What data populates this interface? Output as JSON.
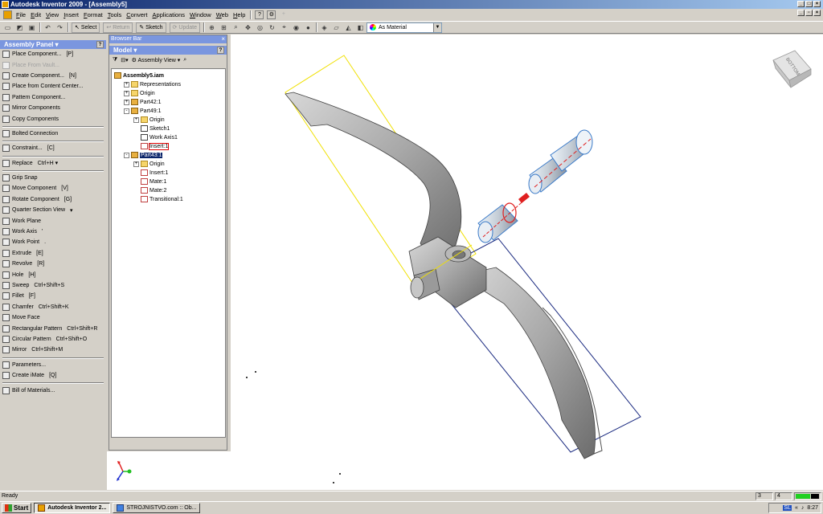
{
  "window": {
    "title": "Autodesk Inventor 2009 - [Assembly5]"
  },
  "menu": [
    "File",
    "Edit",
    "View",
    "Insert",
    "Format",
    "Tools",
    "Convert",
    "Applications",
    "Window",
    "Web",
    "Help"
  ],
  "toolbar": {
    "select_label": "Select",
    "return_label": "Return",
    "sketch_label": "Sketch",
    "update_label": "Update",
    "material_value": "As Material"
  },
  "panel": {
    "title": "Assembly Panel ▾",
    "items": [
      {
        "label": "Place Component...",
        "shortcut": "[P]",
        "icon": "place-component-icon",
        "enabled": true
      },
      {
        "label": "Place From Vault...",
        "shortcut": "",
        "icon": "vault-icon",
        "enabled": false
      },
      {
        "label": "Create Component...",
        "shortcut": "[N]",
        "icon": "create-component-icon",
        "enabled": true
      },
      {
        "label": "Place from Content Center...",
        "shortcut": "",
        "icon": "content-center-icon",
        "enabled": true
      },
      {
        "label": "Pattern Component...",
        "shortcut": "",
        "icon": "pattern-icon",
        "enabled": true
      },
      {
        "label": "Mirror Components",
        "shortcut": "",
        "icon": "mirror-icon",
        "enabled": true
      },
      {
        "label": "Copy Components",
        "shortcut": "",
        "icon": "copy-icon",
        "enabled": true
      },
      {
        "label": "Bolted Connection",
        "shortcut": "",
        "icon": "bolt-icon",
        "enabled": true,
        "sep_before": true
      },
      {
        "label": "Constraint...",
        "shortcut": "[C]",
        "icon": "constraint-icon",
        "enabled": true,
        "sep_before": true
      },
      {
        "label": "Replace",
        "shortcut": "Ctrl+H  ▾",
        "icon": "replace-icon",
        "enabled": true,
        "sep_before": true
      },
      {
        "label": "Grip Snap",
        "shortcut": "",
        "icon": "grip-snap-icon",
        "enabled": true,
        "sep_before": true
      },
      {
        "label": "Move Component",
        "shortcut": "[V]",
        "icon": "move-icon",
        "enabled": true
      },
      {
        "label": "Rotate Component",
        "shortcut": "[G]",
        "icon": "rotate-icon",
        "enabled": true
      },
      {
        "label": "Quarter Section View",
        "shortcut": "▾",
        "icon": "section-icon",
        "enabled": true
      },
      {
        "label": "Work Plane",
        "shortcut": "",
        "icon": "work-plane-icon",
        "enabled": true
      },
      {
        "label": "Work Axis",
        "shortcut": "'",
        "icon": "work-axis-icon",
        "enabled": true
      },
      {
        "label": "Work Point",
        "shortcut": ".",
        "icon": "work-point-icon",
        "enabled": true
      },
      {
        "label": "Extrude",
        "shortcut": "[E]",
        "icon": "extrude-icon",
        "enabled": true
      },
      {
        "label": "Revolve",
        "shortcut": "[R]",
        "icon": "revolve-icon",
        "enabled": true
      },
      {
        "label": "Hole",
        "shortcut": "[H]",
        "icon": "hole-icon",
        "enabled": true
      },
      {
        "label": "Sweep",
        "shortcut": "Ctrl+Shift+S",
        "icon": "sweep-icon",
        "enabled": true
      },
      {
        "label": "Fillet",
        "shortcut": "[F]",
        "icon": "fillet-icon",
        "enabled": true
      },
      {
        "label": "Chamfer",
        "shortcut": "Ctrl+Shift+K",
        "icon": "chamfer-icon",
        "enabled": true
      },
      {
        "label": "Move Face",
        "shortcut": "",
        "icon": "move-face-icon",
        "enabled": true
      },
      {
        "label": "Rectangular Pattern",
        "shortcut": "Ctrl+Shift+R",
        "icon": "rect-pattern-icon",
        "enabled": true
      },
      {
        "label": "Circular Pattern",
        "shortcut": "Ctrl+Shift+O",
        "icon": "circ-pattern-icon",
        "enabled": true
      },
      {
        "label": "Mirror",
        "shortcut": "Ctrl+Shift+M",
        "icon": "mirror-feature-icon",
        "enabled": true
      },
      {
        "label": "Parameters...",
        "shortcut": "",
        "icon": "parameters-icon",
        "enabled": true,
        "sep_before": true
      },
      {
        "label": "Create iMate",
        "shortcut": "[Q]",
        "icon": "imate-icon",
        "enabled": true
      },
      {
        "label": "Bill of Materials...",
        "shortcut": "",
        "icon": "bom-icon",
        "enabled": true,
        "sep_before": true
      }
    ]
  },
  "browser": {
    "title": "Browser Bar",
    "model_label": "Model ▾",
    "view_label": "Assembly View",
    "tree": [
      {
        "label": "Assembly5.iam",
        "level": 0,
        "icon": "assembly-icon",
        "exp": "",
        "bold": true
      },
      {
        "label": "Representations",
        "level": 1,
        "icon": "folder-icon",
        "exp": "+"
      },
      {
        "label": "Origin",
        "level": 1,
        "icon": "folder-icon",
        "exp": "+"
      },
      {
        "label": "Part42:1",
        "level": 1,
        "icon": "part-icon",
        "exp": "+"
      },
      {
        "label": "Part49:1",
        "level": 1,
        "icon": "part-icon",
        "exp": "-"
      },
      {
        "label": "Origin",
        "level": 2,
        "icon": "folder-icon",
        "exp": "+"
      },
      {
        "label": "Sketch1",
        "level": 2,
        "icon": "sketch-icon",
        "exp": ""
      },
      {
        "label": "Work Axis1",
        "level": 2,
        "icon": "work-axis-icon",
        "exp": ""
      },
      {
        "label": "Insert:1",
        "level": 2,
        "icon": "constraint-icon",
        "exp": "",
        "red": true
      },
      {
        "label": "Part43:1",
        "level": 1,
        "icon": "part-icon",
        "exp": "-",
        "highlight": true
      },
      {
        "label": "Origin",
        "level": 2,
        "icon": "folder-icon",
        "exp": "+"
      },
      {
        "label": "Insert:1",
        "level": 2,
        "icon": "constraint-icon",
        "exp": ""
      },
      {
        "label": "Mate:1",
        "level": 2,
        "icon": "constraint-icon",
        "exp": ""
      },
      {
        "label": "Mate:2",
        "level": 2,
        "icon": "constraint-icon",
        "exp": ""
      },
      {
        "label": "Transitional:1",
        "level": 2,
        "icon": "constraint-icon",
        "exp": ""
      }
    ]
  },
  "viewcube": {
    "face_label": "BOTTOM"
  },
  "status": {
    "text": "Ready",
    "box1": "3",
    "box2": "4"
  },
  "taskbar": {
    "start_label": "Start",
    "tasks": [
      {
        "label": "Autodesk Inventor 2...",
        "active": true
      },
      {
        "label": "STROJNISTVO.com :: Ob...",
        "active": false
      }
    ],
    "clock": "8:27"
  },
  "colors": {
    "accent": "#0a246a",
    "panel_header": "#7a96df",
    "sketch_yellow": "#f0e000",
    "sketch_blue": "#1a2a80",
    "constraint_red": "#e02020"
  }
}
